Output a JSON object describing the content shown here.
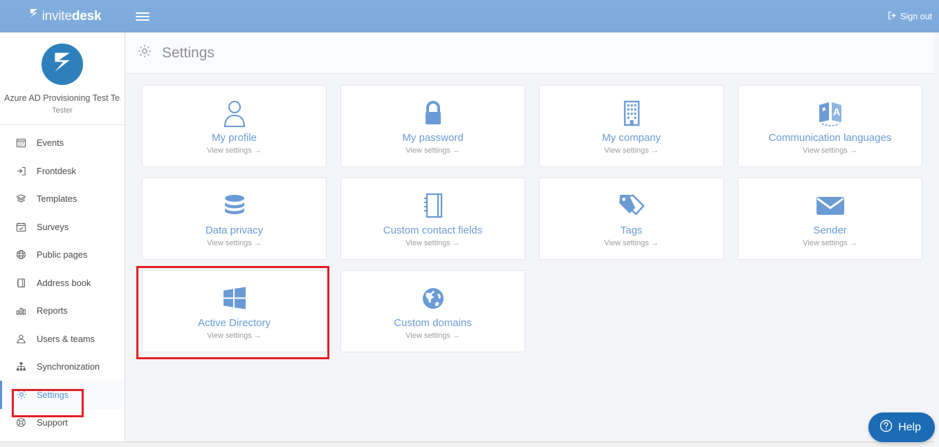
{
  "topbar": {
    "brand_light": "invite",
    "brand_bold": "desk",
    "menu_icon": "hamburger-icon",
    "signout_label": "Sign out",
    "signout_icon": "sign-out-icon",
    "background_color": "#7da9da"
  },
  "sidebar": {
    "team_name": "Azure AD Provisioning Test Team",
    "team_role": "Tester",
    "avatar_icon": "invitedesk-logo-mark",
    "items": [
      {
        "label": "Events",
        "icon": "calendar-icon",
        "active": false
      },
      {
        "label": "Frontdesk",
        "icon": "login-arrow-icon",
        "active": false
      },
      {
        "label": "Templates",
        "icon": "layers-icon",
        "active": false
      },
      {
        "label": "Surveys",
        "icon": "calendar-check-icon",
        "active": false
      },
      {
        "label": "Public pages",
        "icon": "globe-icon",
        "active": false
      },
      {
        "label": "Address book",
        "icon": "book-icon",
        "active": false
      },
      {
        "label": "Reports",
        "icon": "bar-chart-icon",
        "active": false
      },
      {
        "label": "Users & teams",
        "icon": "users-icon",
        "active": false
      },
      {
        "label": "Synchronization",
        "icon": "sitemap-icon",
        "active": false
      },
      {
        "label": "Settings",
        "icon": "gear-icon",
        "active": true
      },
      {
        "label": "Support",
        "icon": "lifebuoy-icon",
        "active": false
      }
    ],
    "active_color": "#5b93d6"
  },
  "header": {
    "title": "Settings",
    "icon": "gear-icon"
  },
  "cards": [
    {
      "title": "My profile",
      "sub": "View settings →",
      "icon": "user-icon"
    },
    {
      "title": "My password",
      "sub": "View settings →",
      "icon": "lock-icon"
    },
    {
      "title": "My company",
      "sub": "View settings →",
      "icon": "building-icon"
    },
    {
      "title": "Communication languages",
      "sub": "View settings →",
      "icon": "translate-icon"
    },
    {
      "title": "Data privacy",
      "sub": "View settings →",
      "icon": "database-icon"
    },
    {
      "title": "Custom contact fields",
      "sub": "View settings →",
      "icon": "notebook-icon"
    },
    {
      "title": "Tags",
      "sub": "View settings →",
      "icon": "tags-icon"
    },
    {
      "title": "Sender",
      "sub": "View settings →",
      "icon": "envelope-icon"
    },
    {
      "title": "Active Directory",
      "sub": "View settings →",
      "icon": "windows-icon",
      "highlighted": true
    },
    {
      "title": "Custom domains",
      "sub": "View settings →",
      "icon": "globe-solid-icon"
    }
  ],
  "help": {
    "label": "Help",
    "icon": "question-circle-icon",
    "color": "#1b6cb5"
  },
  "annotations": {
    "highlight_color": "#e31e24",
    "highlighted_card": "Active Directory",
    "highlighted_nav_item": "Settings"
  }
}
